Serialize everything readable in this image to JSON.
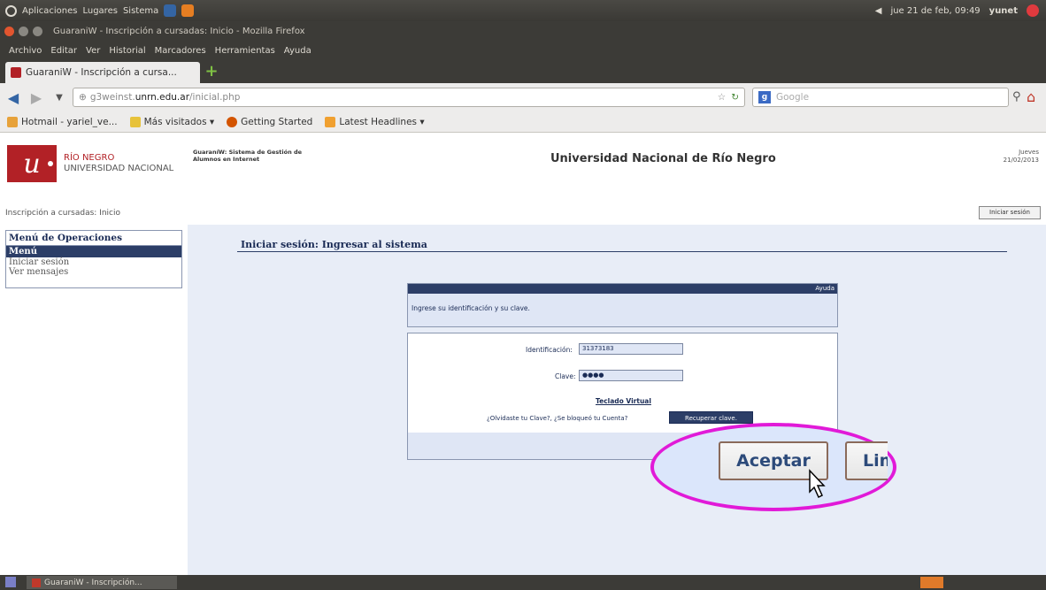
{
  "top_panel": {
    "menus": [
      "Aplicaciones",
      "Lugares",
      "Sistema"
    ],
    "datetime": "jue 21 de feb, 09:49",
    "user": "yunet"
  },
  "window": {
    "title": "GuaraniW - Inscripción a cursadas: Inicio - Mozilla Firefox"
  },
  "menubar": [
    "Archivo",
    "Editar",
    "Ver",
    "Historial",
    "Marcadores",
    "Herramientas",
    "Ayuda"
  ],
  "tab": {
    "label": "GuaraniW - Inscripción a cursa..."
  },
  "url": {
    "prefix": "g3weinst.",
    "host": "unrn.edu.ar",
    "path": "/inicial.php"
  },
  "search": {
    "placeholder": "Google"
  },
  "bookmarks": [
    "Hotmail - yariel_ve...",
    "Más visitados ▾",
    "Getting Started",
    "Latest Headlines ▾"
  ],
  "header": {
    "logo_line1": "RÍO NEGRO",
    "logo_line2": "UNIVERSIDAD NACIONAL",
    "system_title": "GuaraníW: Sistema de Gestión de Alumnos en Internet",
    "university": "Universidad Nacional de Río Negro",
    "day": "Jueves",
    "date": "21/02/2013"
  },
  "breadcrumb": "Inscripción a cursadas: Inicio",
  "login_top_button": "Iniciar sesión",
  "sidebar": {
    "title": "Menú de Operaciones",
    "active": "Menú",
    "items": [
      "Iniciar sesión",
      "Ver mensajes"
    ]
  },
  "section_title": "Iniciar sesión: Ingresar al sistema",
  "help": {
    "label": "Ayuda",
    "message": "Ingrese su identificación y su clave."
  },
  "form": {
    "id_label": "Identificación:",
    "id_value": "31373183",
    "pass_label": "Clave:",
    "pass_value": "●●●●",
    "keyboard_link": "Teclado Virtual",
    "forgot_text": "¿Olvidaste tu Clave?, ¿Se bloqueó tu Cuenta?",
    "recover_button": "Recuperar clave.",
    "accept_button": "Aceptar",
    "clear_button": "Lim"
  },
  "taskbar": {
    "item": "GuaraniW - Inscripción..."
  },
  "colors": {
    "brand_red": "#b22126",
    "navy": "#2c3e67",
    "highlight": "#e11ad8"
  }
}
